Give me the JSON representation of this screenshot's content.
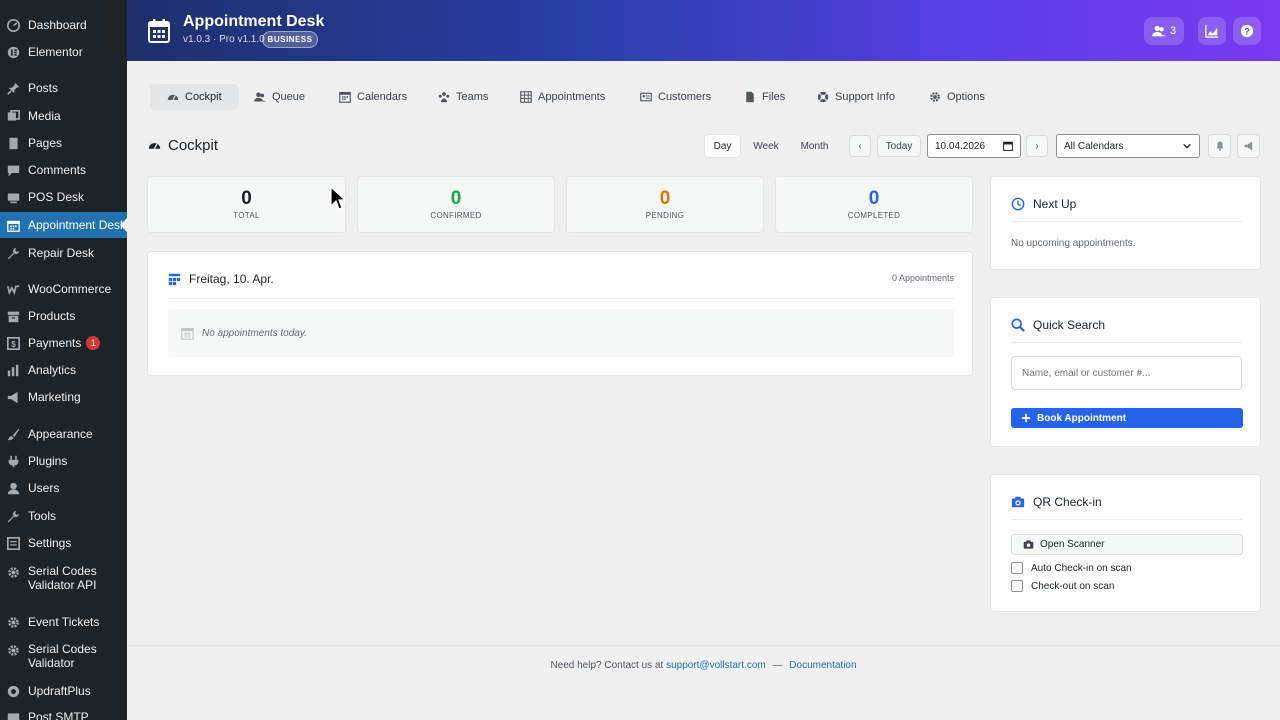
{
  "sidebar": {
    "items": [
      {
        "label": "Dashboard",
        "icon": "dashboard-icon"
      },
      {
        "label": "Elementor",
        "icon": "elementor-icon"
      },
      {
        "label": "Posts",
        "icon": "pin-icon"
      },
      {
        "label": "Media",
        "icon": "media-icon"
      },
      {
        "label": "Pages",
        "icon": "pages-icon"
      },
      {
        "label": "Comments",
        "icon": "comment-icon"
      },
      {
        "label": "POS Desk",
        "icon": "pos-icon"
      },
      {
        "label": "Appointment Desk",
        "icon": "calendar-icon",
        "active": true
      },
      {
        "label": "Repair Desk",
        "icon": "wrench-icon"
      },
      {
        "label": "WooCommerce",
        "icon": "woo-icon"
      },
      {
        "label": "Products",
        "icon": "archive-icon"
      },
      {
        "label": "Payments",
        "icon": "dollar-icon",
        "badge": "1"
      },
      {
        "label": "Analytics",
        "icon": "chart-icon"
      },
      {
        "label": "Marketing",
        "icon": "megaphone-icon"
      },
      {
        "label": "Appearance",
        "icon": "brush-icon"
      },
      {
        "label": "Plugins",
        "icon": "plug-icon"
      },
      {
        "label": "Users",
        "icon": "user-icon"
      },
      {
        "label": "Tools",
        "icon": "tool-icon"
      },
      {
        "label": "Settings",
        "icon": "settings-icon"
      },
      {
        "label": "Serial Codes Validator API",
        "line1": "Serial Codes",
        "line2": "Validator API",
        "icon": "gear-icon"
      },
      {
        "label": "Event Tickets",
        "icon": "gear-icon"
      },
      {
        "label": "Serial Codes Validator",
        "line1": "Serial Codes",
        "line2": "Validator",
        "icon": "gear-icon"
      },
      {
        "label": "UpdraftPlus",
        "icon": "updraft-icon"
      },
      {
        "label": "Post SMTP",
        "icon": "mail-icon"
      }
    ]
  },
  "header": {
    "title": "Appointment Desk",
    "version": "v1.0.3 · Pro v1.1.0",
    "badge": "BUSINESS",
    "queue_count": "3",
    "accent_from": "#1e2f6b",
    "accent_to": "#7a3af0"
  },
  "tabs": [
    {
      "label": "Cockpit",
      "icon": "dashboard-icon",
      "active": true
    },
    {
      "label": "Queue",
      "icon": "users-icon"
    },
    {
      "label": "Calendars",
      "icon": "calendar-icon"
    },
    {
      "label": "Teams",
      "icon": "team-icon"
    },
    {
      "label": "Appointments",
      "icon": "table-icon"
    },
    {
      "label": "Customers",
      "icon": "id-card-icon"
    },
    {
      "label": "Files",
      "icon": "file-icon"
    },
    {
      "label": "Support Info",
      "icon": "lifebuoy-icon"
    },
    {
      "label": "Options",
      "icon": "gear-icon"
    }
  ],
  "toolbar": {
    "page_title": "Cockpit",
    "views": [
      "Day",
      "Week",
      "Month"
    ],
    "active_view": "Day",
    "prev": "‹",
    "today": "Today",
    "next": "›",
    "date": "10.04.2026",
    "calendar_select": "All Calendars"
  },
  "stats": [
    {
      "value": "0",
      "label": "TOTAL",
      "color": "#1d2327"
    },
    {
      "value": "0",
      "label": "CONFIRMED",
      "color": "#16a34a"
    },
    {
      "value": "0",
      "label": "PENDING",
      "color": "#d97706"
    },
    {
      "value": "0",
      "label": "COMPLETED",
      "color": "#2563eb"
    }
  ],
  "day_panel": {
    "date": "Freitag, 10. Apr.",
    "count": "0 Appointments",
    "empty": "No appointments today."
  },
  "next_up": {
    "title": "Next Up",
    "empty": "No upcoming appointments."
  },
  "quick_search": {
    "title": "Quick Search",
    "placeholder": "Name, email or customer #...",
    "book_label": "Book Appointment",
    "book_color": "#2563eb"
  },
  "qr": {
    "title": "QR Check-in",
    "open_scanner": "Open Scanner",
    "auto_checkin": "Auto Check-in on scan",
    "checkout": "Check-out on scan"
  },
  "footer": {
    "help": "Need help? Contact us at",
    "email": "support@vollstart.com",
    "sep": "—",
    "docs": "Documentation"
  }
}
